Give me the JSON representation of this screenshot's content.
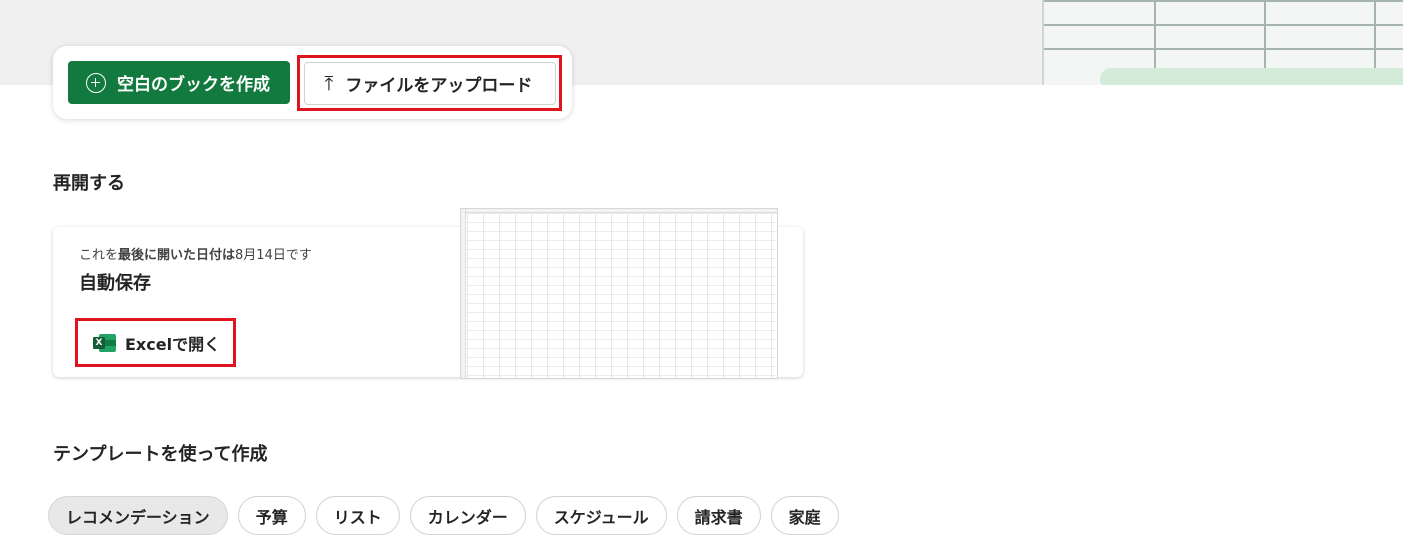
{
  "actions": {
    "new_blank_label": "空白のブックを作成",
    "upload_label": "ファイルをアップロード"
  },
  "recent": {
    "section_title": "再開する",
    "subtitle_prefix": "これを",
    "subtitle_bold": "最後に開いた日付は",
    "subtitle_date": "8月14日です",
    "file_name": "自動保存",
    "open_label": "Excelで開く"
  },
  "templates": {
    "section_title": "テンプレートを使って作成",
    "chips": [
      {
        "label": "レコメンデーション",
        "selected": true
      },
      {
        "label": "予算",
        "selected": false
      },
      {
        "label": "リスト",
        "selected": false
      },
      {
        "label": "カレンダー",
        "selected": false
      },
      {
        "label": "スケジュール",
        "selected": false
      },
      {
        "label": "請求書",
        "selected": false
      },
      {
        "label": "家庭",
        "selected": false
      }
    ]
  },
  "icons": {
    "new_blank": "plus-circle-icon",
    "upload": "arrow-up-to-line-icon",
    "excel": "excel-app-icon"
  },
  "colors": {
    "accent_green": "#137a3f",
    "highlight_red": "#e0141e"
  }
}
